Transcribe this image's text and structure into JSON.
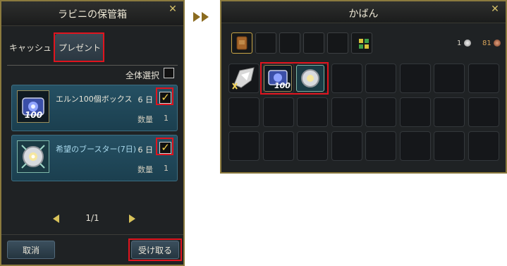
{
  "storage_window": {
    "title": "ラビニの保管箱",
    "tabs": [
      {
        "label": "キャッシュ"
      },
      {
        "label": "プレゼント"
      }
    ],
    "select_all_label": "全体選択",
    "items": [
      {
        "name": "エルン100個ボックス",
        "days": "6 日",
        "qty_label": "数量",
        "qty": "1",
        "badge": "100",
        "checked": true
      },
      {
        "name": "希望のブースター(7日)",
        "days": "6 日",
        "qty_label": "数量",
        "qty": "1",
        "checked": true
      }
    ],
    "pagination": "1/1",
    "cancel_label": "取消",
    "receive_label": "受け取る"
  },
  "bag_window": {
    "title": "かばん",
    "currency_1": "1",
    "currency_2": "81",
    "slot_badge": "100"
  },
  "colors": {
    "frame_gold": "#8b7a3e",
    "highlight_red": "#e0141e",
    "check_yellow": "#f2d14b"
  },
  "icons": [
    "close-icon",
    "chevron-left-icon",
    "chevron-right-icon",
    "checkmark-icon",
    "double-arrow-right-icon",
    "coin-icon"
  ]
}
